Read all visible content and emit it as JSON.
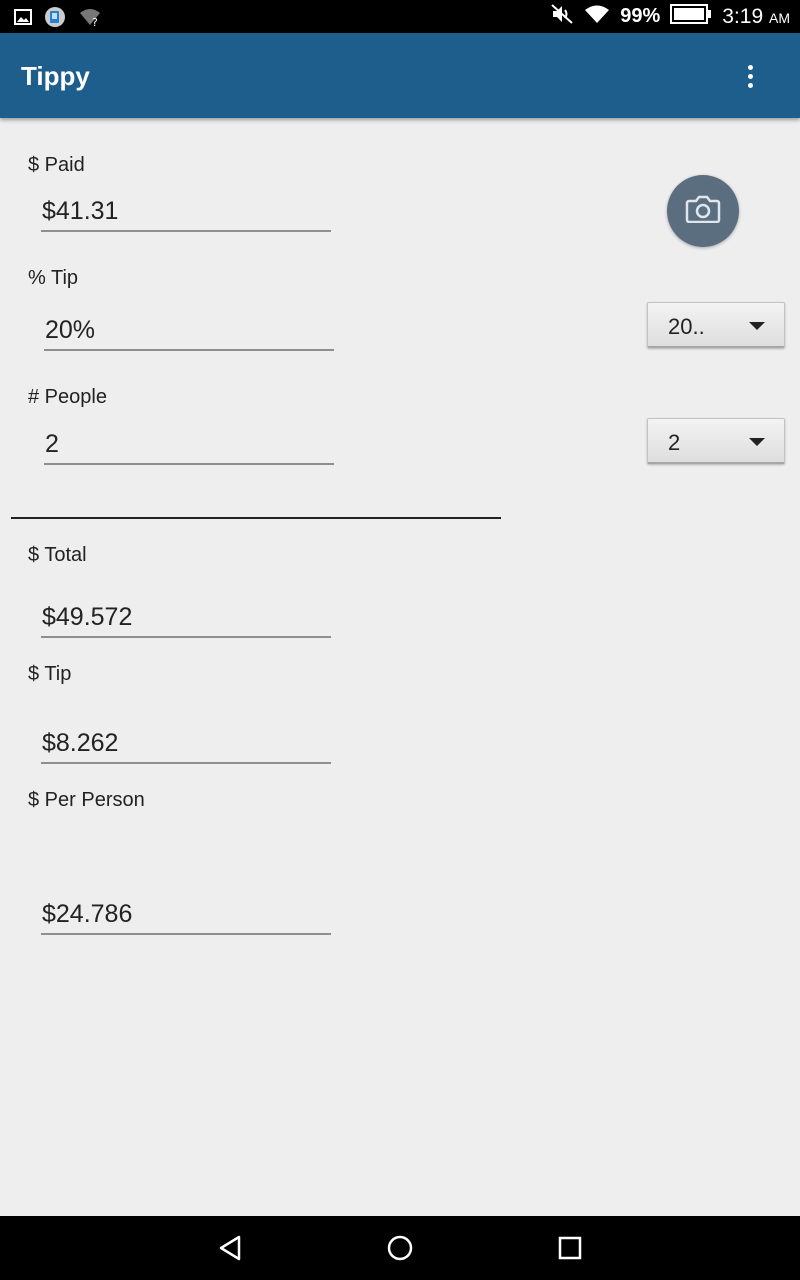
{
  "status_bar": {
    "battery": "99%",
    "time": "3:19",
    "ampm": "AM",
    "icons": [
      "gallery-icon",
      "app-notification-icon",
      "wifi-question-icon",
      "mute-icon",
      "wifi-icon",
      "battery-icon"
    ]
  },
  "app_bar": {
    "title": "Tippy",
    "overflow_icon": "more-vert-icon"
  },
  "form": {
    "paid_label": "$ Paid",
    "paid_value": "$41.31",
    "tip_percent_label": "% Tip",
    "tip_percent_value": "20%",
    "people_label": "# People",
    "people_value": "2",
    "camera_icon": "camera-icon"
  },
  "spinners": {
    "tip_selected": "20..",
    "people_selected": "2"
  },
  "results": {
    "total_label": "$ Total",
    "total_value": "$49.572",
    "tip_label": "$ Tip",
    "tip_value": "$8.262",
    "per_person_label": "$ Per Person",
    "per_person_value": "$24.786"
  },
  "nav_bar": {
    "icons": [
      "back-icon",
      "home-icon",
      "recents-icon"
    ]
  },
  "colors": {
    "app_bar": "#1e5e8c",
    "background": "#eeeeee",
    "fab": "#5b6e80"
  }
}
